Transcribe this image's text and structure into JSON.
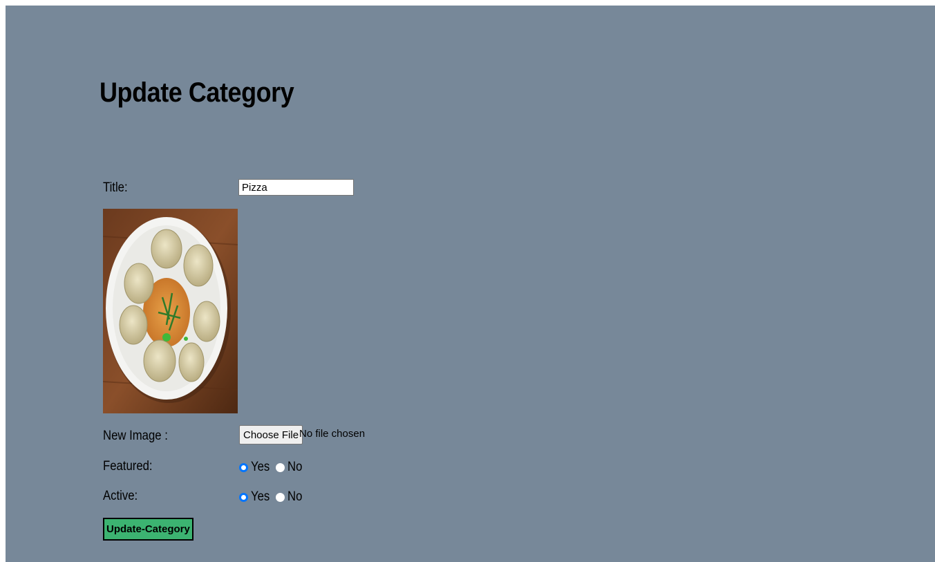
{
  "heading": "Update Category",
  "form": {
    "title_label": "Title:",
    "title_value": "Pizza",
    "new_image_label": "New Image :",
    "file_button": "Choose File",
    "file_status": "No file chosen",
    "featured_label": "Featured:",
    "active_label": "Active:",
    "yes_label": "Yes",
    "no_label": "No",
    "featured_selected": "Yes",
    "active_selected": "Yes",
    "submit_label": "Update-Category"
  },
  "colors": {
    "page_background": "#778899",
    "submit_background": "#3cb371",
    "radio_accent": "#0075ff"
  }
}
